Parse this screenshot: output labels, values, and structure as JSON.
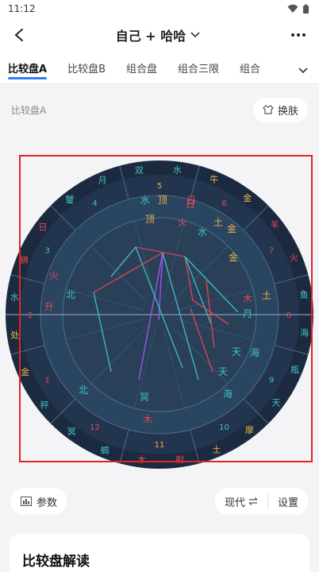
{
  "status": {
    "time": "11:12"
  },
  "header": {
    "title": "自己 + 哈哈"
  },
  "tabs": [
    "比较盘A",
    "比较盘B",
    "组合盘",
    "组合三限",
    "组合"
  ],
  "section": {
    "title": "比较盘A",
    "skin_label": "换肤"
  },
  "chart": {
    "signs_outer": [
      "双",
      "水",
      "牛",
      "金",
      "羊",
      "火",
      "鱼",
      "海",
      "瓶",
      "天",
      "摩",
      "土",
      "射",
      "木",
      "蝎",
      "冥",
      "秤",
      "金",
      "处",
      "水",
      "狮",
      "日",
      "蟹",
      "月"
    ],
    "house_numbers": [
      "1",
      "2",
      "3",
      "4",
      "5",
      "6",
      "7",
      "8",
      "9",
      "10",
      "11",
      "12"
    ],
    "planets_inner": [
      "水",
      "顶",
      "日",
      "火",
      "顶",
      "土",
      "金",
      "水",
      "金",
      "木",
      "土",
      "月",
      "天",
      "海",
      "天",
      "海",
      "冥",
      "木",
      "北",
      "升",
      "火",
      "北",
      "日"
    ],
    "colors": {
      "bg_outer": "#1c2a40",
      "ring": "#3c5a78",
      "inner": "#2a4560",
      "red": "#e5484d",
      "cyan": "#3fc4c0",
      "gold": "#e8b54a",
      "purple": "#a855f7",
      "frame": "#e02424"
    }
  },
  "bottom": {
    "params_label": "参数",
    "mode_label": "现代",
    "settings_label": "设置"
  },
  "reading": {
    "title": "比较盘解读"
  }
}
